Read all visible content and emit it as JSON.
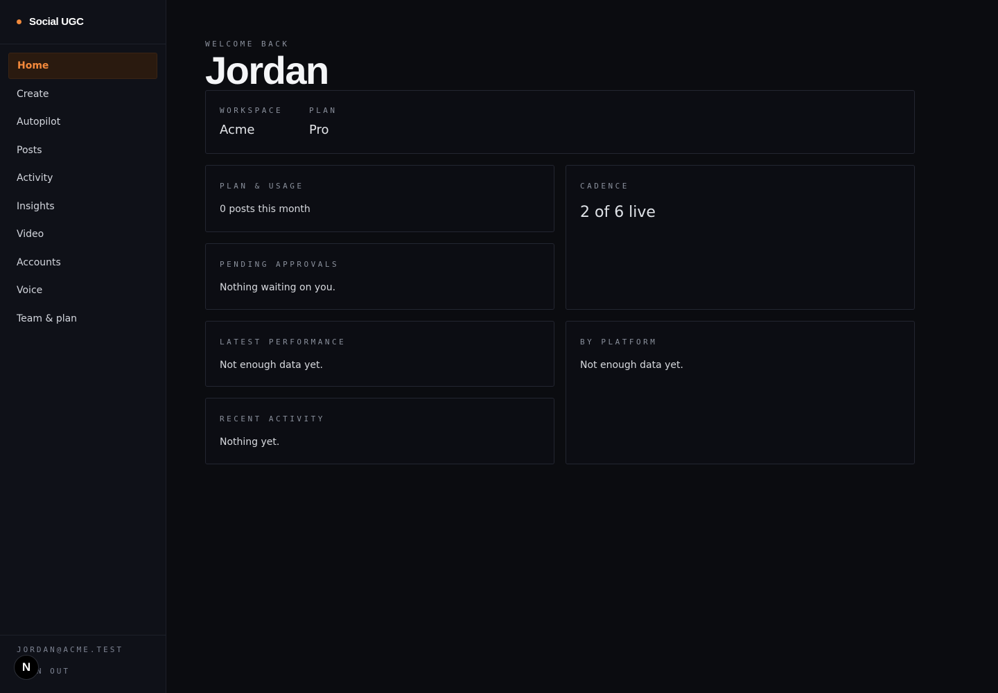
{
  "brand": {
    "name": "Social UGC",
    "accent": "#f08a3c"
  },
  "sidebar": {
    "items": [
      {
        "label": "Home",
        "active": true
      },
      {
        "label": "Create"
      },
      {
        "label": "Autopilot"
      },
      {
        "label": "Posts"
      },
      {
        "label": "Activity"
      },
      {
        "label": "Insights"
      },
      {
        "label": "Video"
      },
      {
        "label": "Accounts"
      },
      {
        "label": "Voice"
      },
      {
        "label": "Team & plan"
      }
    ],
    "footer": {
      "email": "JORDAN@ACME.TEST",
      "signout": "SIGN OUT"
    },
    "badge": "N"
  },
  "header": {
    "eyebrow": "WELCOME BACK",
    "name": "Jordan"
  },
  "workspace": {
    "workspace_label": "WORKSPACE",
    "workspace_value": "Acme",
    "plan_label": "PLAN",
    "plan_value": "Pro"
  },
  "cards": {
    "plan_usage": {
      "label": "PLAN & USAGE",
      "text": "0 posts this month"
    },
    "cadence": {
      "label": "CADENCE",
      "text": "2 of 6 live"
    },
    "pending": {
      "label": "PENDING APPROVALS",
      "text": "Nothing waiting on you."
    },
    "performance": {
      "label": "LATEST PERFORMANCE",
      "text": "Not enough data yet."
    },
    "platform": {
      "label": "BY PLATFORM",
      "text": "Not enough data yet."
    },
    "recent": {
      "label": "RECENT ACTIVITY",
      "text": "Nothing yet."
    }
  }
}
